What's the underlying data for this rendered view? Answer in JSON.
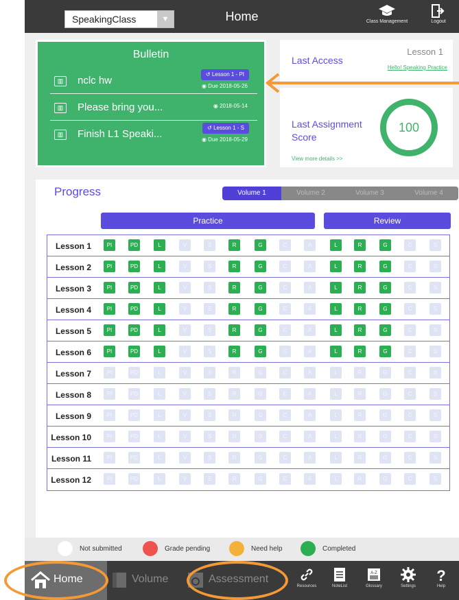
{
  "header": {
    "class_selector_value": "SpeakingClass",
    "title": "Home",
    "class_management_label": "Class Management",
    "logout_label": "Logout"
  },
  "bulletin": {
    "title": "Bulletin",
    "items": [
      {
        "text": "nclc hw",
        "tag": "Lesson 1 - PI",
        "due": "Due 2018-05-26"
      },
      {
        "text": "Please bring you...",
        "tag": "",
        "due": "2018-05-14"
      },
      {
        "text": "Finish L1 Speaki...",
        "tag": "Lesson 1 - S",
        "due": "Due 2018-05-29"
      }
    ]
  },
  "last_access": {
    "label": "Last Access",
    "lesson": "Lesson 1",
    "link": "Hello! Speaking Practice"
  },
  "last_assignment": {
    "label": "Last Assignment Score",
    "score": "100",
    "more_link": "View more details >>"
  },
  "progress": {
    "title": "Progress",
    "volume_tabs": [
      "Volume 1",
      "Volume 2",
      "Volume 3",
      "Volume 4"
    ],
    "active_volume": "Volume 1",
    "practice_header": "Practice",
    "review_header": "Review",
    "cell_labels": [
      "PI",
      "PD",
      "L",
      "V",
      "S",
      "R",
      "G",
      "C",
      "A",
      "L",
      "R",
      "G",
      "C",
      "S"
    ],
    "lessons": [
      {
        "label": "Lesson 1",
        "completed": [
          1,
          1,
          1,
          0,
          0,
          1,
          1,
          0,
          0,
          1,
          1,
          1,
          0,
          0
        ]
      },
      {
        "label": "Lesson 2",
        "completed": [
          1,
          1,
          1,
          0,
          0,
          1,
          1,
          0,
          0,
          1,
          1,
          1,
          0,
          0
        ]
      },
      {
        "label": "Lesson 3",
        "completed": [
          1,
          1,
          1,
          0,
          0,
          1,
          1,
          0,
          0,
          1,
          1,
          1,
          0,
          0
        ]
      },
      {
        "label": "Lesson 4",
        "completed": [
          1,
          1,
          1,
          0,
          0,
          1,
          1,
          0,
          0,
          1,
          1,
          1,
          0,
          0
        ]
      },
      {
        "label": "Lesson 5",
        "completed": [
          1,
          1,
          1,
          0,
          0,
          1,
          1,
          0,
          0,
          1,
          1,
          1,
          0,
          0
        ]
      },
      {
        "label": "Lesson 6",
        "completed": [
          1,
          1,
          1,
          0,
          0,
          1,
          1,
          0,
          0,
          1,
          1,
          1,
          0,
          0
        ]
      },
      {
        "label": "Lesson 7",
        "completed": [
          0,
          0,
          0,
          0,
          0,
          0,
          0,
          0,
          0,
          0,
          0,
          0,
          0,
          0
        ]
      },
      {
        "label": "Lesson 8",
        "completed": [
          0,
          0,
          0,
          0,
          0,
          0,
          0,
          0,
          0,
          0,
          0,
          0,
          0,
          0
        ]
      },
      {
        "label": "Lesson 9",
        "completed": [
          0,
          0,
          0,
          0,
          0,
          0,
          0,
          0,
          0,
          0,
          0,
          0,
          0,
          0
        ]
      },
      {
        "label": "Lesson 10",
        "completed": [
          0,
          0,
          0,
          0,
          0,
          0,
          0,
          0,
          0,
          0,
          0,
          0,
          0,
          0
        ]
      },
      {
        "label": "Lesson 11",
        "completed": [
          0,
          0,
          0,
          0,
          0,
          0,
          0,
          0,
          0,
          0,
          0,
          0,
          0,
          0
        ]
      },
      {
        "label": "Lesson 12",
        "completed": [
          0,
          0,
          0,
          0,
          0,
          0,
          0,
          0,
          0,
          0,
          0,
          0,
          0,
          0
        ]
      }
    ]
  },
  "legend": [
    {
      "label": "Not submitted",
      "color": "#ffffff"
    },
    {
      "label": "Grade pending",
      "color": "#ef5350"
    },
    {
      "label": "Need help",
      "color": "#f4b13a"
    },
    {
      "label": "Completed",
      "color": "#2cae53"
    }
  ],
  "bottom_nav": {
    "home": "Home",
    "volume": "Volume",
    "assessment": "Assessment",
    "resources": "Resources",
    "notelist": "NoteList",
    "glossary": "Glossary",
    "settings": "Settings",
    "help": "Help"
  },
  "colors": {
    "brand_green": "#3fb36b",
    "accent_purple": "#5b4ce0",
    "annotation_orange": "#f39a37"
  }
}
